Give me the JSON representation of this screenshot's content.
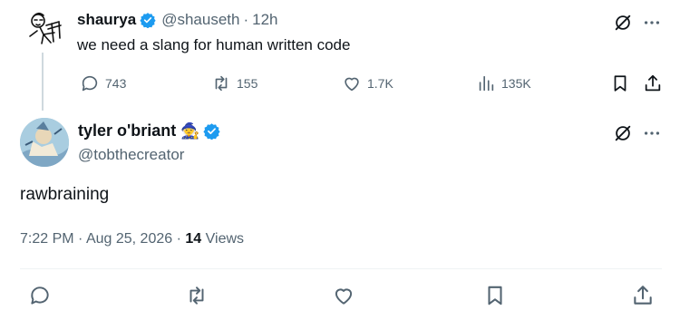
{
  "parent_tweet": {
    "name": "shaurya",
    "handle": "@shauseth",
    "separator": "·",
    "time": "12h",
    "text": "we need a slang for human written code",
    "replies": "743",
    "reposts": "155",
    "likes": "1.7K",
    "views": "135K"
  },
  "reply_tweet": {
    "name": "tyler o'briant",
    "name_emoji": "🧙",
    "handle": "@tobthecreator",
    "text": "rawbraining",
    "time": "7:22 PM",
    "date": "Aug 25, 2026",
    "sep": "·",
    "views_count": "14",
    "views_label": "Views"
  },
  "colors": {
    "verified_blue": "#1d9bf0",
    "muted_text": "#536471",
    "thread_line": "#cfd9de"
  },
  "icons": [
    "verified-badge-icon",
    "grok-icon",
    "more-icon",
    "reply-icon",
    "repost-icon",
    "like-icon",
    "views-icon",
    "bookmark-icon",
    "share-icon"
  ]
}
